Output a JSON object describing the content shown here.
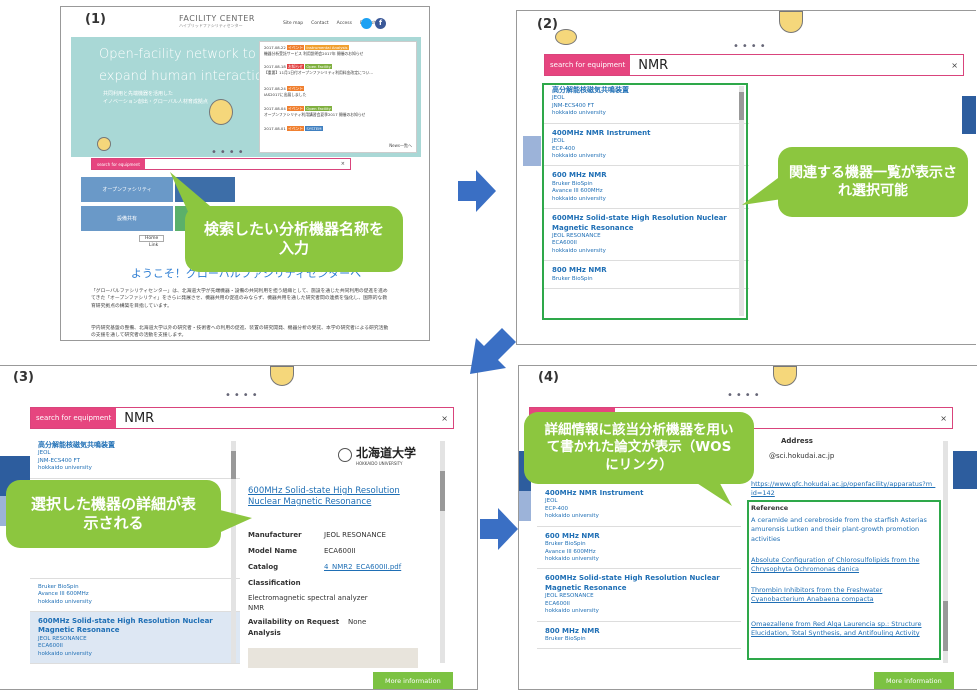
{
  "steps": [
    "(1)",
    "(2)",
    "(3)",
    "(4)"
  ],
  "panel1": {
    "logo_text": "FACILITY CENTER",
    "logo_sub": "ハイブリッドファシリティセンター",
    "nav": [
      "Site map",
      "Contact",
      "Access",
      "English"
    ],
    "hero_line1": "Open-facility network to",
    "hero_line2": "expand human interaction.",
    "hero_jp1": "共同利用と先端機器を活用した",
    "hero_jp2": "イノベーション創出・グローバル人材育成拠点",
    "news": [
      {
        "date": "2017.08.22",
        "tag1": "イベント",
        "tag2": "Instrumental Analysis",
        "text": "機器分析受託サービス 利用説明会2017年 開催のお知らせ"
      },
      {
        "date": "2017.08.18",
        "tag1": "お知らせ",
        "tag2": "Open Facility",
        "text": "【重要】11月1日付オープンファシリティ利用料金改定につい..."
      },
      {
        "date": "2017.08.24",
        "tag1": "イベント",
        "tag2": "",
        "text": "IAS2017に出展しました"
      },
      {
        "date": "2017.08.04",
        "tag1": "イベント",
        "tag2": "Open Facility",
        "text": "オープンファシリティ利用講習会夏季2017 開催のお知らせ"
      },
      {
        "date": "2017.08.01",
        "tag1": "イベント",
        "tag2": "SYSTEM",
        "text": ""
      }
    ],
    "news_more": "News一覧へ",
    "search_label": "search for equipment",
    "search_close": "×",
    "tiles": [
      "オープンファシリティ",
      "設備共有"
    ],
    "tabs": [
      "Home",
      "Link"
    ],
    "welcome": "ようこそ！グローバルファシリティセンターへ",
    "body1": "「グローバルファシリティセンター」は、北海道大学が先端機器・設備の共同利用を担う組織として、施設を通じた共同利用の促進を進めてきた「オープンファシリティ」をさらに発展させ、機器共用の促進のみならず、機器共用を通した研究者間の連携を強化し、国際的な教育研究拠点の構築を目指しています。",
    "body2": "学内研究基盤の整備、北海道大学以外の研究者・技術者への利用の促進、装置の研究開発、機器分析の受託、本学の研究者による研究活動の支援を通して研究者の活動を支援します。",
    "callout": "検索したい分析機器名称を入力"
  },
  "search_query": "NMR",
  "results": [
    {
      "title": "高分解能核磁気共鳴装置",
      "maker": "JEOL",
      "model": "JNM-ECS400 FT",
      "org": "hokkaido university"
    },
    {
      "title": "400MHz NMR Instrument",
      "maker": "JEOL",
      "model": "ECP-400",
      "org": "hokkaido university"
    },
    {
      "title": "600 MHz NMR",
      "maker": "Bruker BioSpin",
      "model": "Avance III 600MHz",
      "org": "hokkaido university"
    },
    {
      "title": "600MHz Solid-state High Resolution Nuclear Magnetic Resonance",
      "maker": "JEOL RESONANCE",
      "model": "ECA600II",
      "org": "hokkaido university"
    },
    {
      "title": "800 MHz NMR",
      "maker": "Bruker BioSpin",
      "model": "",
      "org": ""
    }
  ],
  "panel2": {
    "callout": "関連する機器一覧が表示され選択可能"
  },
  "panel3": {
    "university_logo": "北海道大学",
    "university_logo_en": "HOKKAIDO UNIVERSITY",
    "detail_title": "600MHz Solid-state High Resolution Nuclear Magnetic Resonance",
    "manufacturer_k": "Manufacturer",
    "manufacturer_v": "JEOL RESONANCE",
    "model_k": "Model Name",
    "model_v": "ECA600II",
    "catalog_k": "Catalog",
    "catalog_v": "4_NMR2_ECA600II.pdf",
    "class_k": "Classification",
    "class_v1": "Electromagnetic spectral analyzer",
    "class_v2": "NMR",
    "avail_k": "Availability on Request Analysis",
    "avail_v": "None",
    "more": "More information",
    "callout": "選択した機器の詳細が表示される"
  },
  "panel4": {
    "address_k": "Address",
    "email": "@sci.hokudai.ac.jp",
    "url": "https://www.gfc.hokudai.ac.jp/openfacility/apparatus?m_id=142",
    "reference_k": "Reference",
    "refs": [
      "A ceramide and cerebroside from the starfish Asterias amurensis Lutken and their plant-growth promotion activities",
      "Absolute Configuration of Chlorosulfolipids from the Chrysophyta Ochromonas danica",
      "Thrombin Inhibitors from the Freshwater Cyanobacterium Anabaena compacta",
      "Omaezallene from Red Alga Laurencia sp.: Structure Elucidation, Total Synthesis, and Antifouling Activity"
    ],
    "more": "More information",
    "callout": "詳細情報に該当分析機器を用いて書かれた論文が表示（WOSにリンク）"
  },
  "colors": {
    "accent_pink": "#e6457f",
    "callout_green": "#8cc63f",
    "highlight_green": "#2ea84a",
    "arrow_blue": "#3a6fc4",
    "link_blue": "#1f6fb5"
  }
}
